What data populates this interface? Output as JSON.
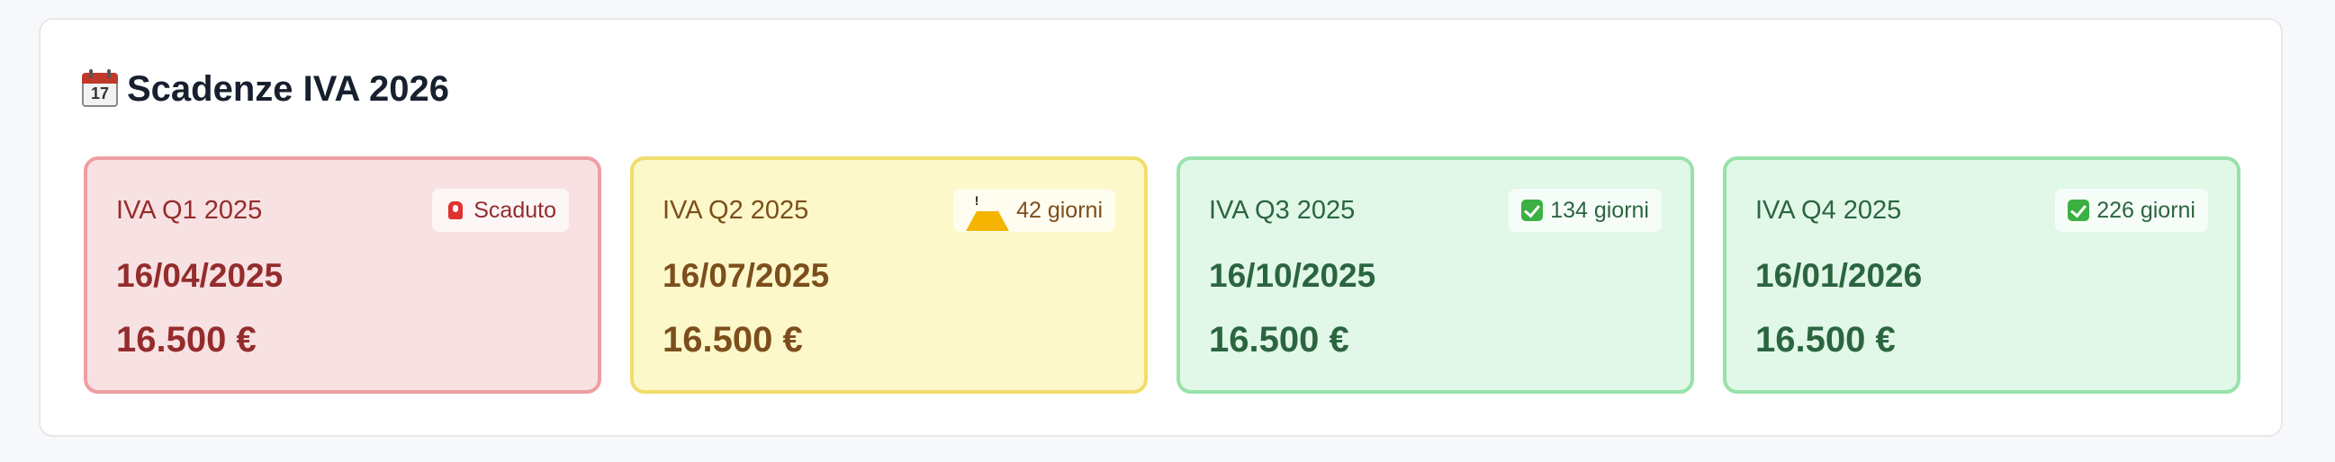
{
  "section": {
    "title": "Scadenze IVA 2026",
    "title_icon": "calendar-icon",
    "calendar_day": "17"
  },
  "cards": [
    {
      "label": "IVA Q1 2025",
      "status_icon": "alarm-icon",
      "status_text": "Scaduto",
      "date": "16/04/2025",
      "amount": "16.500 €",
      "state": "overdue",
      "color": "#f8e1e2"
    },
    {
      "label": "IVA Q2 2025",
      "status_icon": "warning-icon",
      "status_text": "42 giorni",
      "date": "16/07/2025",
      "amount": "16.500 €",
      "state": "warning",
      "color": "#fcf8c9"
    },
    {
      "label": "IVA Q3 2025",
      "status_icon": "check-icon",
      "status_text": "134 giorni",
      "date": "16/10/2025",
      "amount": "16.500 €",
      "state": "ok",
      "color": "#e1f8e8"
    },
    {
      "label": "IVA Q4 2025",
      "status_icon": "check-icon",
      "status_text": "226 giorni",
      "date": "16/01/2026",
      "amount": "16.500 €",
      "state": "ok",
      "color": "#e1f8e8"
    }
  ]
}
